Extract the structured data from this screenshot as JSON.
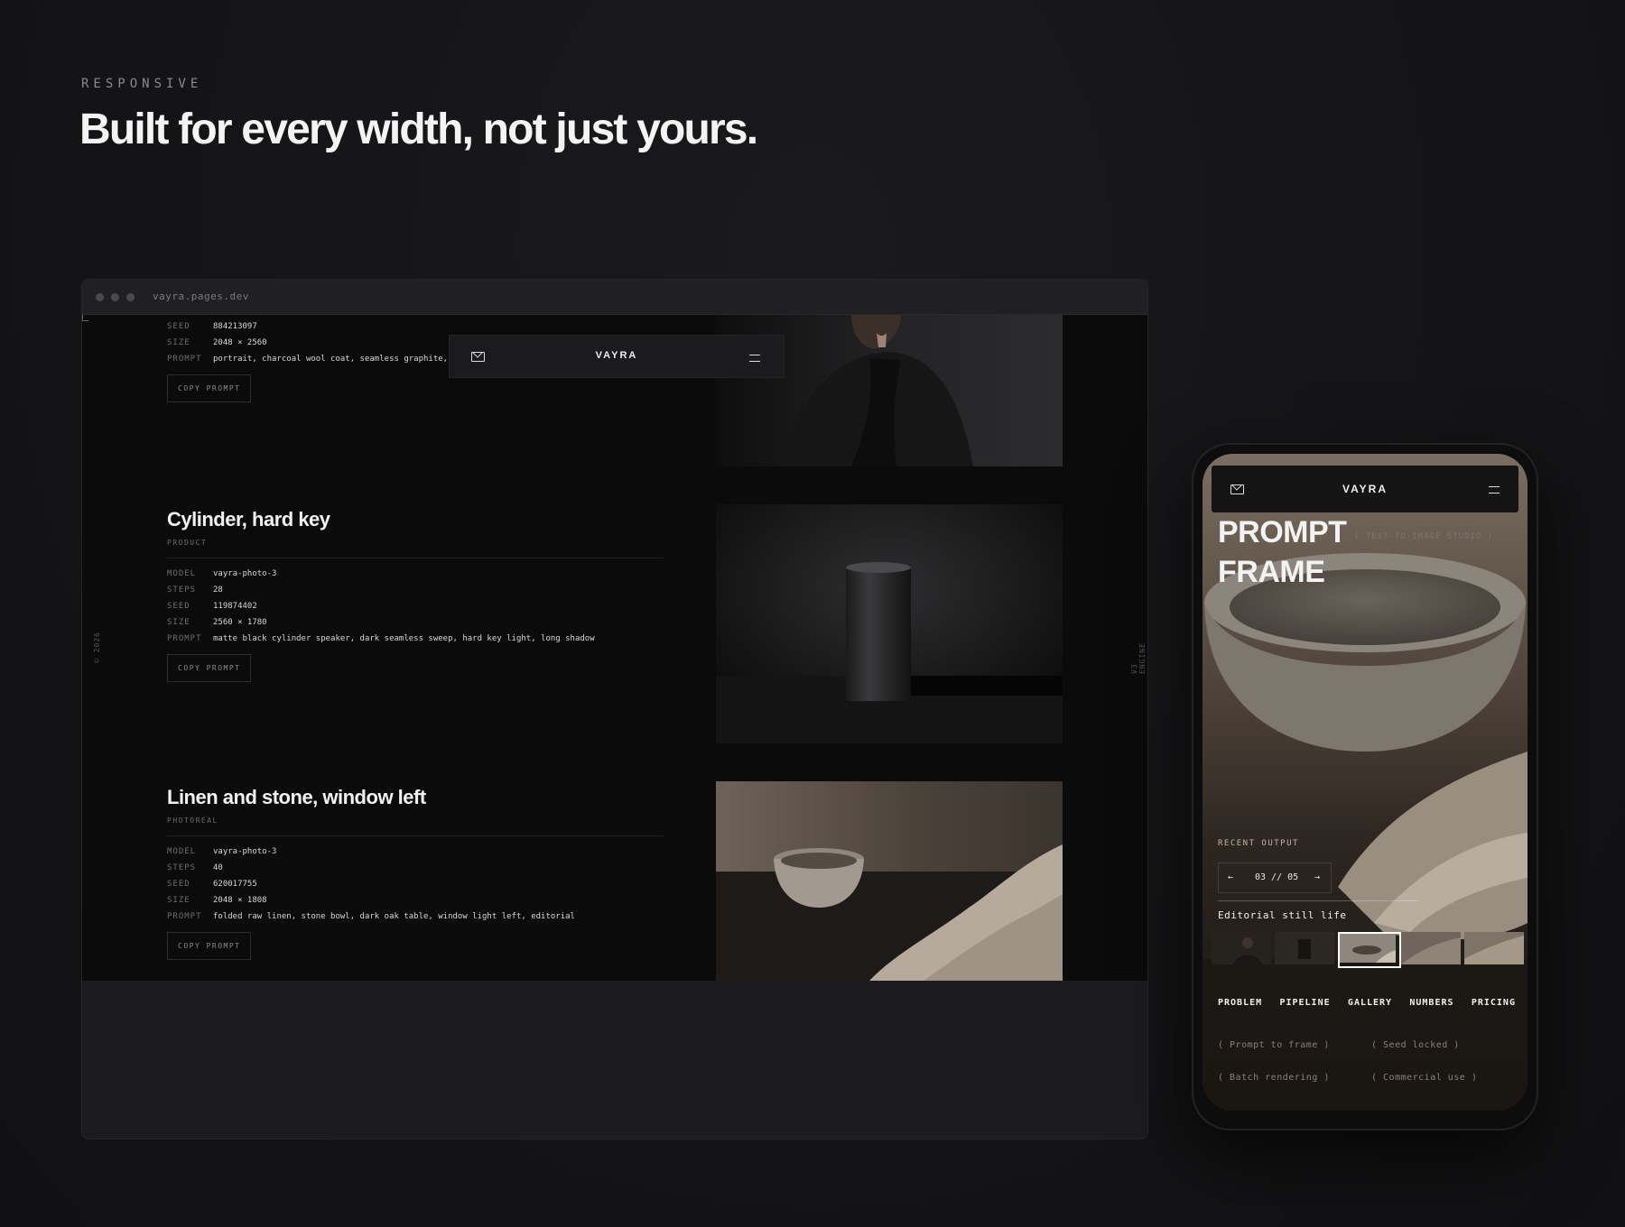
{
  "section": {
    "eyebrow": "RESPONSIVE",
    "headline": "Built for every width, not just yours."
  },
  "browser": {
    "url": "vayra.pages.dev",
    "side_left": "© 2026",
    "side_right": "V3 ENGINE",
    "nav": {
      "brand": "VAYRA"
    },
    "items": [
      {
        "specs": [
          {
            "key": "SEED",
            "value": "884213097"
          },
          {
            "key": "SIZE",
            "value": "2048 × 2560"
          },
          {
            "key": "PROMPT",
            "value": "portrait, charcoal wool coat, seamless graphite,"
          }
        ],
        "copy_label": "COPY PROMPT"
      },
      {
        "title": "Cylinder, hard key",
        "category": "PRODUCT",
        "specs": [
          {
            "key": "MODEL",
            "value": "vayra-photo-3"
          },
          {
            "key": "STEPS",
            "value": "28"
          },
          {
            "key": "SEED",
            "value": "119874402"
          },
          {
            "key": "SIZE",
            "value": "2560 × 1780"
          },
          {
            "key": "PROMPT",
            "value": "matte black cylinder speaker, dark seamless sweep, hard key light, long shadow"
          }
        ],
        "copy_label": "COPY PROMPT"
      },
      {
        "title": "Linen and stone, window left",
        "category": "PHOTOREAL",
        "specs": [
          {
            "key": "MODEL",
            "value": "vayra-photo-3"
          },
          {
            "key": "STEPS",
            "value": "40"
          },
          {
            "key": "SEED",
            "value": "620017755"
          },
          {
            "key": "SIZE",
            "value": "2048 × 1808"
          },
          {
            "key": "PROMPT",
            "value": "folded raw linen, stone bowl, dark oak table, window light left, editorial"
          }
        ],
        "copy_label": "COPY PROMPT"
      }
    ]
  },
  "phone": {
    "brand": "VAYRA",
    "title_line1": "PROMPT",
    "title_line2": "FRAME",
    "tagline": "( TEXT-TO-IMAGE STUDIO )",
    "recent_label": "RECENT OUTPUT",
    "pager": {
      "prev": "←",
      "counter": "03 // 05",
      "next": "→"
    },
    "caption": "Editorial still life",
    "menu": [
      "PROBLEM",
      "PIPELINE",
      "GALLERY",
      "NUMBERS",
      "PRICING"
    ],
    "pills": [
      "( Prompt to frame )",
      "( Seed locked )",
      "( Batch rendering )",
      "( Commercial use )"
    ]
  }
}
